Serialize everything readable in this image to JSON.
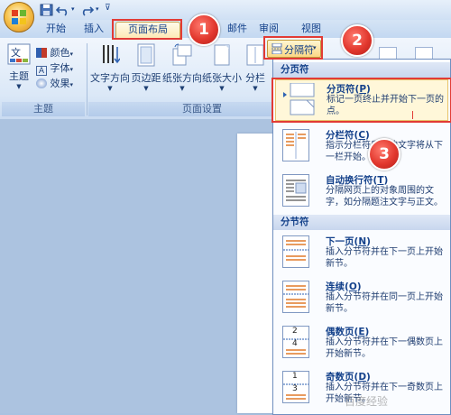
{
  "tabs": [
    "开始",
    "插入",
    "页面布局",
    "邮件",
    "审阅",
    "视图"
  ],
  "theme_group": {
    "main_label": "主题",
    "colors": "颜色",
    "fonts": "字体",
    "effects": "效果",
    "group_label": "主题"
  },
  "page_setup": {
    "buttons": [
      "文字方向",
      "页边距",
      "纸张方向",
      "纸张大小",
      "分栏"
    ],
    "group_label": "页面设置"
  },
  "breaks_button": "分隔符",
  "menu": {
    "section_page": "分页符",
    "section_section": "分节符",
    "items": [
      {
        "title": "分页符(",
        "key": "P",
        "title_end": ")",
        "desc": "标记一页终止并开始下一页的点。"
      },
      {
        "title": "分栏符(",
        "key": "C",
        "title_end": ")",
        "desc": "指示分栏符后面的文字将从下一栏开始。"
      },
      {
        "title": "自动换行符(",
        "key": "T",
        "title_end": ")",
        "desc": "分隔网页上的对象周围的文字，如分隔题注文字与正文。"
      },
      {
        "title": "下一页(",
        "key": "N",
        "title_end": ")",
        "desc": "插入分节符并在下一页上开始新节。"
      },
      {
        "title": "连续(",
        "key": "O",
        "title_end": ")",
        "desc": "插入分节符并在同一页上开始新节。"
      },
      {
        "title": "偶数页(",
        "key": "E",
        "title_end": ")",
        "desc": "插入分节符并在下一偶数页上开始新节。"
      },
      {
        "title": "奇数页(",
        "key": "D",
        "title_end": ")",
        "desc": "插入分节符并在下一奇数页上开始新节。"
      }
    ],
    "icon_numbers": {
      "even": "2",
      "even_next": "4",
      "odd": "1",
      "odd_next": "3"
    }
  },
  "callouts": [
    "1",
    "2",
    "3"
  ],
  "watermark": "百度经验"
}
